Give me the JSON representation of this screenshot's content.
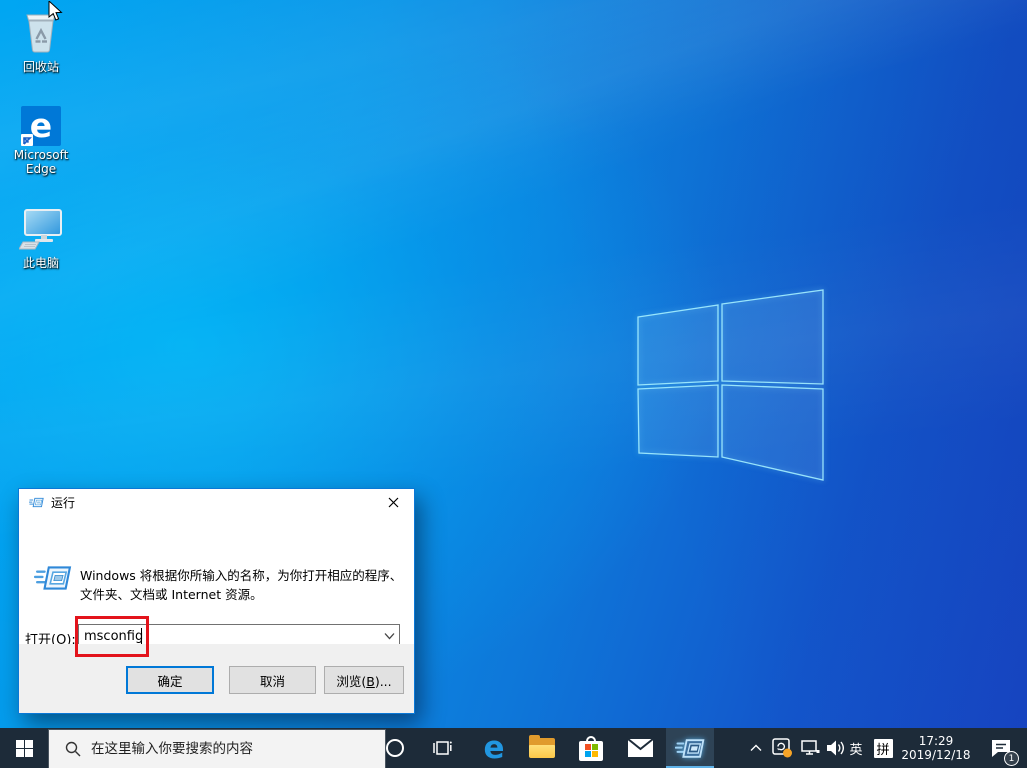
{
  "desktop_icons": {
    "recycle_bin": "回收站",
    "edge": "Microsoft Edge",
    "this_pc": "此电脑",
    "edge_glyph": "e"
  },
  "run_dialog": {
    "title": "运行",
    "description_line1": "Windows 将根据你所输入的名称，为你打开相应的程序、",
    "description_line2": "文件夹、文档或 Internet 资源。",
    "open_label_pre": "打开(",
    "open_label_key": "O",
    "open_label_suffix": "):",
    "input_value": "msconfig",
    "ok_label": "确定",
    "cancel_label": "取消",
    "browse_pre": "浏览(",
    "browse_key": "B",
    "browse_suffix": ")..."
  },
  "taskbar": {
    "search_placeholder": "在这里输入你要搜索的内容",
    "edge_glyph": "e",
    "tray": {
      "ime_language": "英",
      "ime_mode": "拼",
      "time": "17:29",
      "date": "2019/12/18",
      "notification_badge": "1"
    }
  },
  "colors": {
    "accent": "#0078d7",
    "annotation_red": "#e3131b",
    "taskbar_bg": "#1d2b39",
    "wallpaper_bright": "#00a6f2",
    "wallpaper_deep": "#1847c5"
  }
}
